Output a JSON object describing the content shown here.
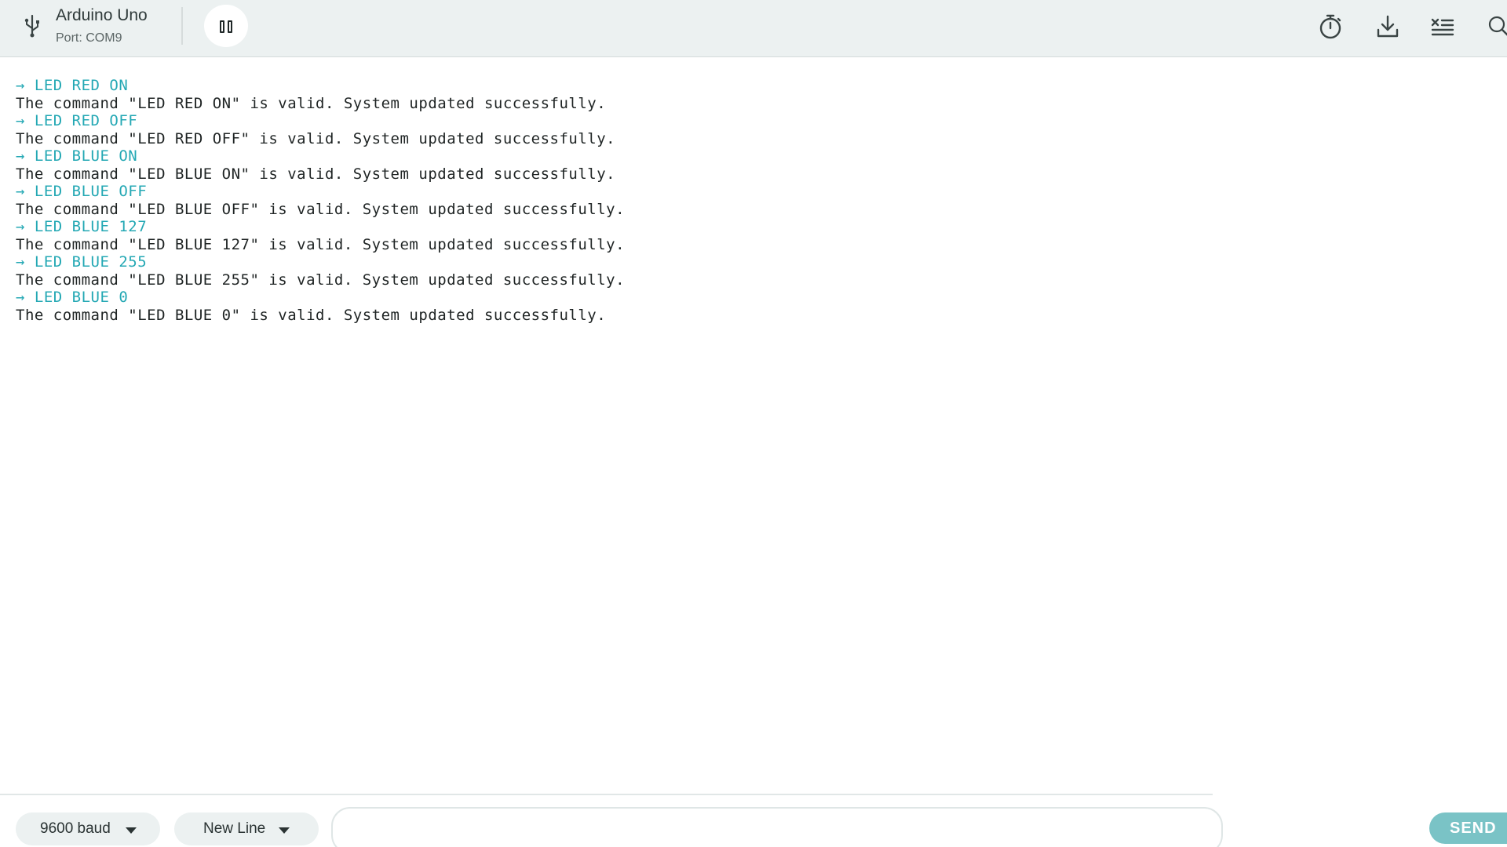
{
  "header": {
    "board_name": "Arduino Uno",
    "port": "Port: COM9",
    "icons": {
      "usb": "usb-icon",
      "pause": "pause-icon",
      "timestamp": "timer-icon",
      "download": "download-icon",
      "clear": "clear-output-icon",
      "search": "search-icon"
    }
  },
  "output": {
    "lines": [
      {
        "kind": "cmd",
        "text": "→ LED RED ON"
      },
      {
        "kind": "resp",
        "text": "The command \"LED RED ON\" is valid. System updated successfully."
      },
      {
        "kind": "cmd",
        "text": "→ LED RED OFF"
      },
      {
        "kind": "resp",
        "text": "The command \"LED RED OFF\" is valid. System updated successfully."
      },
      {
        "kind": "cmd",
        "text": "→ LED BLUE ON"
      },
      {
        "kind": "resp",
        "text": "The command \"LED BLUE ON\" is valid. System updated successfully."
      },
      {
        "kind": "cmd",
        "text": "→ LED BLUE OFF"
      },
      {
        "kind": "resp",
        "text": "The command \"LED BLUE OFF\" is valid. System updated successfully."
      },
      {
        "kind": "cmd",
        "text": "→ LED BLUE 127"
      },
      {
        "kind": "resp",
        "text": "The command \"LED BLUE 127\" is valid. System updated successfully."
      },
      {
        "kind": "cmd",
        "text": "→ LED BLUE 255"
      },
      {
        "kind": "resp",
        "text": "The command \"LED BLUE 255\" is valid. System updated successfully."
      },
      {
        "kind": "cmd",
        "text": "→ LED BLUE 0"
      },
      {
        "kind": "resp",
        "text": "The command \"LED BLUE 0\" is valid. System updated successfully."
      }
    ]
  },
  "footer": {
    "baud_rate": "9600 baud",
    "line_ending": "New Line",
    "message_value": "",
    "send_label": "SEND"
  },
  "colors": {
    "command_text": "#24a8b4",
    "response_text": "#1f2424",
    "toolbar_bg": "#ecf1f1",
    "send_button": "#7ac3c6"
  }
}
